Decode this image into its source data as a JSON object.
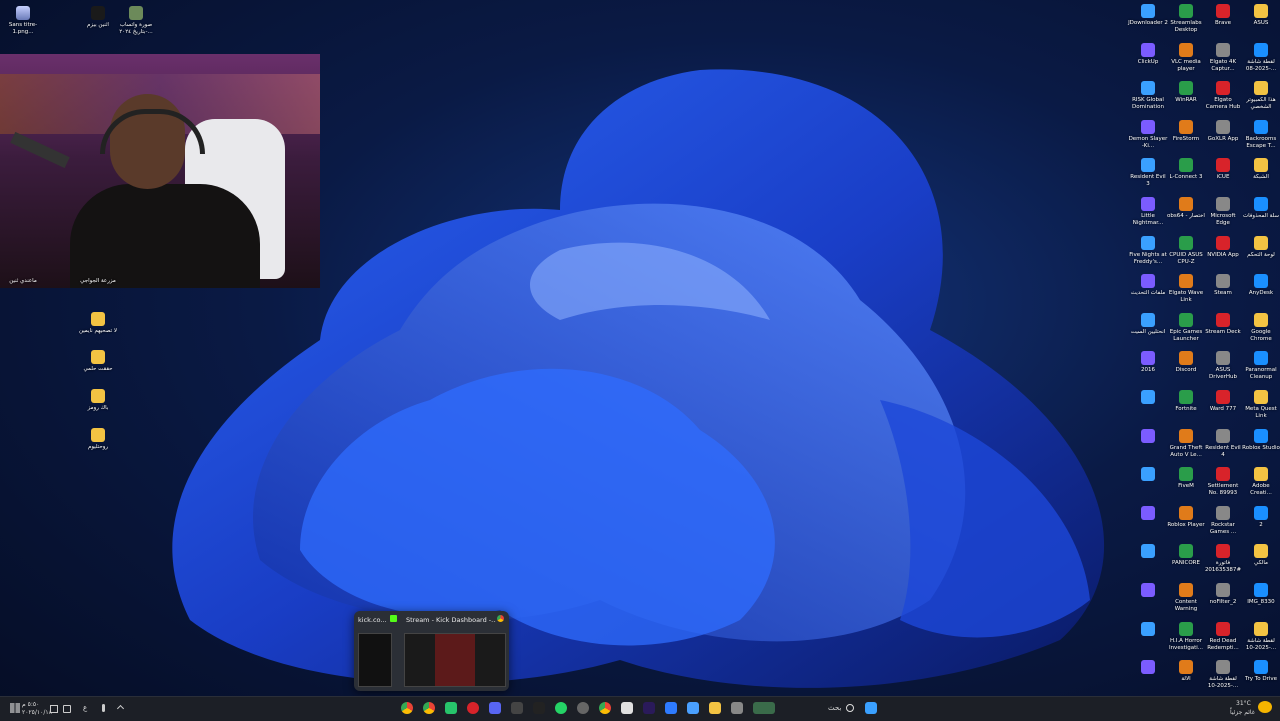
{
  "colors": {
    "taskbar_bg": "#1c1f26",
    "wallpaper_accent": "#1a56ff",
    "folder": "#f3c343"
  },
  "desktop_left": [
    {
      "label": "Sans titre-1.png..."
    },
    {
      "label": "اثنين بيزم"
    },
    {
      "label": "صورة واتساب بتاريخ ٢٠٢٤-..."
    },
    {
      "label": "ماعندي ثنين"
    },
    {
      "label": "مزرعة الجواجي"
    },
    {
      "label": "لا تصحيهم نايمين"
    },
    {
      "label": "حققت حلمي"
    },
    {
      "label": "باك رومز"
    },
    {
      "label": "روحتليوم"
    }
  ],
  "desktop_right": [
    {
      "label": "JDownloader 2"
    },
    {
      "label": "Streamlabs Desktop"
    },
    {
      "label": "Brave"
    },
    {
      "label": "ASUS"
    },
    {
      "label": "ClickUp"
    },
    {
      "label": "VLC media player"
    },
    {
      "label": "Elgato 4K Captur..."
    },
    {
      "label": "لقطة شاشة 2025-08-..."
    },
    {
      "label": "RISK Global Domination"
    },
    {
      "label": "WinRAR"
    },
    {
      "label": "Elgato Camera Hub"
    },
    {
      "label": "هذا الكمبيوتر الشخصي"
    },
    {
      "label": "Demon Slayer -Ki..."
    },
    {
      "label": "FireStorm"
    },
    {
      "label": "GoXLR App"
    },
    {
      "label": "Backrooms Escape T..."
    },
    {
      "label": "Resident Evil 3"
    },
    {
      "label": "L-Connect 3"
    },
    {
      "label": "iCUE"
    },
    {
      "label": "الشبكة"
    },
    {
      "label": "Little Nightmar..."
    },
    {
      "label": "obs64 - اختصار"
    },
    {
      "label": "Microsoft Edge"
    },
    {
      "label": "سلة المحذوفات"
    },
    {
      "label": "Five Nights at Freddy's..."
    },
    {
      "label": "CPUID ASUS CPU-Z"
    },
    {
      "label": "NVIDIA App"
    },
    {
      "label": "لوحة التحكم"
    },
    {
      "label": "ملفات التحديث"
    },
    {
      "label": "Elgato Wave Link"
    },
    {
      "label": "Steam"
    },
    {
      "label": "AnyDesk"
    },
    {
      "label": "انحتليين السيت"
    },
    {
      "label": "Epic Games Launcher"
    },
    {
      "label": "Stream Deck"
    },
    {
      "label": "Google Chrome"
    },
    {
      "label": "2016"
    },
    {
      "label": "Discord"
    },
    {
      "label": "ASUS DriverHub"
    },
    {
      "label": "Paranormal Cleanup"
    },
    {
      "label": ""
    },
    {
      "label": "Fortnite"
    },
    {
      "label": "Ward 777"
    },
    {
      "label": "Meta Quest Link"
    },
    {
      "label": ""
    },
    {
      "label": "Grand Theft Auto V Le..."
    },
    {
      "label": "Resident Evil 4"
    },
    {
      "label": "Roblox Studio"
    },
    {
      "label": ""
    },
    {
      "label": "FiveM"
    },
    {
      "label": "Settlement No. 89993"
    },
    {
      "label": "Adobe Creati..."
    },
    {
      "label": ""
    },
    {
      "label": "Roblox Player"
    },
    {
      "label": "Rockstar Games ..."
    },
    {
      "label": "2"
    },
    {
      "label": ""
    },
    {
      "label": "PANICORE"
    },
    {
      "label": "فاتورة #201635387"
    },
    {
      "label": "مالكي"
    },
    {
      "label": ""
    },
    {
      "label": "Content Warning"
    },
    {
      "label": "noFilter_2"
    },
    {
      "label": "IMG_8330"
    },
    {
      "label": ""
    },
    {
      "label": "H.I.A Horror Investigati..."
    },
    {
      "label": "Red Dead Redempti..."
    },
    {
      "label": "لقطة شاشة 2025-10-..."
    },
    {
      "label": ""
    },
    {
      "label": "الالة"
    },
    {
      "label": "لقطة شاشة 2025-10-..."
    },
    {
      "label": "Try To Drive"
    }
  ],
  "preview": {
    "tab1_title": "kick.co...",
    "tab2_title": "Stream - Kick Dashboard -..."
  },
  "taskbar": {
    "search_label": "بحث",
    "weather_temp": "31°C",
    "weather_desc": "غائم جزئياً",
    "clock_time": "٥:٥٠ م",
    "clock_date": "٢٠٢٥/١٠/١٨",
    "lang": "ع",
    "icons": [
      "chrome-icon",
      "chrome-alt-icon",
      "app-green-icon",
      "opera-icon",
      "discord-icon",
      "xbox-icon",
      "capcut-icon",
      "whatsapp-icon",
      "settings-icon",
      "chrome-3-icon",
      "calendar-icon",
      "premiere-icon",
      "edit-icon",
      "photos-icon",
      "explorer-icon",
      "app-icon",
      "widgets-icon"
    ]
  }
}
